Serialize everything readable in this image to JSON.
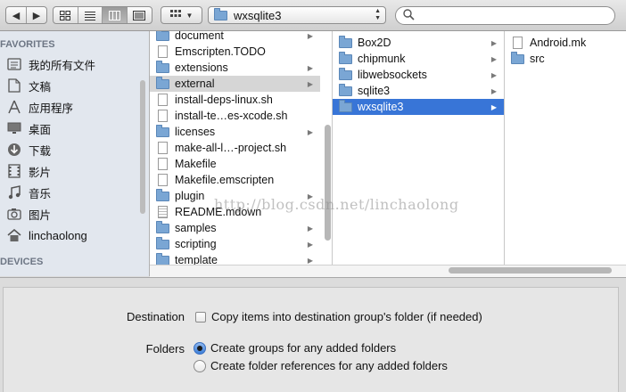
{
  "toolbar": {
    "back_icon": "back-arrow-icon",
    "forward_icon": "forward-arrow-icon",
    "view_modes": [
      "icon-view",
      "list-view",
      "column-view",
      "coverflow-view"
    ],
    "active_view": 2,
    "arrange_icon": "arrange-grid-icon",
    "path": "wxsqlite3",
    "search_placeholder": ""
  },
  "sidebar": {
    "favorites_heading": "FAVORITES",
    "items": [
      {
        "label": "我的所有文件",
        "icon": "all-my-files-icon"
      },
      {
        "label": "文稿",
        "icon": "documents-icon"
      },
      {
        "label": "应用程序",
        "icon": "applications-icon"
      },
      {
        "label": "桌面",
        "icon": "desktop-icon"
      },
      {
        "label": "下载",
        "icon": "downloads-icon"
      },
      {
        "label": "影片",
        "icon": "movies-icon"
      },
      {
        "label": "音乐",
        "icon": "music-icon"
      },
      {
        "label": "图片",
        "icon": "pictures-icon"
      },
      {
        "label": "linchaolong",
        "icon": "home-icon"
      }
    ],
    "devices_heading": "DEVICES"
  },
  "column1": [
    {
      "name": "document",
      "kind": "folder",
      "arrow": true
    },
    {
      "name": "Emscripten.TODO",
      "kind": "file",
      "arrow": false
    },
    {
      "name": "extensions",
      "kind": "folder",
      "arrow": true
    },
    {
      "name": "external",
      "kind": "folder",
      "arrow": true,
      "selected": "gray"
    },
    {
      "name": "install-deps-linux.sh",
      "kind": "file",
      "arrow": false
    },
    {
      "name": "install-te…es-xcode.sh",
      "kind": "file",
      "arrow": false
    },
    {
      "name": "licenses",
      "kind": "folder",
      "arrow": true
    },
    {
      "name": "make-all-l…-project.sh",
      "kind": "file",
      "arrow": false
    },
    {
      "name": "Makefile",
      "kind": "file",
      "arrow": false
    },
    {
      "name": "Makefile.emscripten",
      "kind": "file",
      "arrow": false
    },
    {
      "name": "plugin",
      "kind": "folder",
      "arrow": true
    },
    {
      "name": "README.mdown",
      "kind": "doc",
      "arrow": false
    },
    {
      "name": "samples",
      "kind": "folder",
      "arrow": true
    },
    {
      "name": "scripting",
      "kind": "folder",
      "arrow": true
    },
    {
      "name": "template",
      "kind": "folder",
      "arrow": true
    }
  ],
  "column2": [
    {
      "name": "Box2D",
      "kind": "folder",
      "arrow": true
    },
    {
      "name": "chipmunk",
      "kind": "folder",
      "arrow": true
    },
    {
      "name": "libwebsockets",
      "kind": "folder",
      "arrow": true
    },
    {
      "name": "sqlite3",
      "kind": "folder",
      "arrow": true
    },
    {
      "name": "wxsqlite3",
      "kind": "folder",
      "arrow": true,
      "selected": "blue"
    }
  ],
  "column3": [
    {
      "name": "Android.mk",
      "kind": "file",
      "arrow": false
    },
    {
      "name": "src",
      "kind": "folder",
      "arrow": false
    }
  ],
  "options": {
    "destination_label": "Destination",
    "copy_items_label": "Copy items into destination group's folder (if needed)",
    "copy_checked": false,
    "folders_label": "Folders",
    "radio_groups_label": "Create groups for any added folders",
    "radio_references_label": "Create folder references for any added folders",
    "selected_radio": "groups"
  },
  "watermark": "http://blog.csdn.net/linchaolong"
}
